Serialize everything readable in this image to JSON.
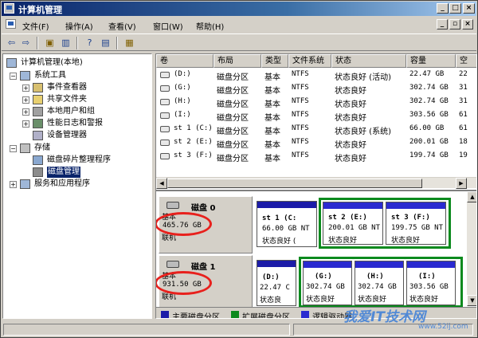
{
  "window": {
    "title": "计算机管理"
  },
  "menu": [
    "文件(F)",
    "操作(A)",
    "查看(V)",
    "窗口(W)",
    "帮助(H)"
  ],
  "tree": {
    "root": "计算机管理(本地)",
    "system_tools": "系统工具",
    "event_viewer": "事件查看器",
    "shared_folders": "共享文件夹",
    "local_users": "本地用户和组",
    "perf_logs": "性能日志和警报",
    "device_manager": "设备管理器",
    "storage": "存储",
    "defrag": "磁盘碎片整理程序",
    "disk_mgmt": "磁盘管理",
    "services_apps": "服务和应用程序"
  },
  "columns": [
    "卷",
    "布局",
    "类型",
    "文件系统",
    "状态",
    "容量",
    "空"
  ],
  "volumes": [
    {
      "name": "(D:)",
      "layout": "磁盘分区",
      "type": "基本",
      "fs": "NTFS",
      "status": "状态良好 (活动)",
      "capacity": "22.47 GB",
      "free": "22"
    },
    {
      "name": "(G:)",
      "layout": "磁盘分区",
      "type": "基本",
      "fs": "NTFS",
      "status": "状态良好",
      "capacity": "302.74 GB",
      "free": "31"
    },
    {
      "name": "(H:)",
      "layout": "磁盘分区",
      "type": "基本",
      "fs": "NTFS",
      "status": "状态良好",
      "capacity": "302.74 GB",
      "free": "31"
    },
    {
      "name": "(I:)",
      "layout": "磁盘分区",
      "type": "基本",
      "fs": "NTFS",
      "status": "状态良好",
      "capacity": "303.56 GB",
      "free": "61"
    },
    {
      "name": "st 1 (C:)",
      "layout": "磁盘分区",
      "type": "基本",
      "fs": "NTFS",
      "status": "状态良好 (系统)",
      "capacity": "66.00 GB",
      "free": "61"
    },
    {
      "name": "st 2 (E:)",
      "layout": "磁盘分区",
      "type": "基本",
      "fs": "NTFS",
      "status": "状态良好",
      "capacity": "200.01 GB",
      "free": "18"
    },
    {
      "name": "st 3 (F:)",
      "layout": "磁盘分区",
      "type": "基本",
      "fs": "NTFS",
      "status": "状态良好",
      "capacity": "199.74 GB",
      "free": "19"
    }
  ],
  "disks": [
    {
      "name": "磁盘 0",
      "type": "基本",
      "size": "465.76 GB",
      "status": "联机",
      "partitions": [
        {
          "name": "st 1 (C:",
          "size": "66.00 GB NT",
          "status": "状态良好 ("
        },
        {
          "name": "st 2 (E:)",
          "size": "200.01 GB NT",
          "status": "状态良好"
        },
        {
          "name": "st 3 (F:)",
          "size": "199.75 GB NT",
          "status": "状态良好"
        }
      ]
    },
    {
      "name": "磁盘 1",
      "type": "基本",
      "size": "931.50 GB",
      "status": "联机",
      "partitions": [
        {
          "name": "(D:)",
          "size": "22.47 C",
          "status": "状态良"
        },
        {
          "name": "(G:)",
          "size": "302.74 GB",
          "status": "状态良好"
        },
        {
          "name": "(H:)",
          "size": "302.74 GB",
          "status": "状态良好"
        },
        {
          "name": "(I:)",
          "size": "303.56 GB",
          "status": "状态良好"
        }
      ]
    }
  ],
  "legend": [
    {
      "label": "主要磁盘分区",
      "color": "#1c1ca8"
    },
    {
      "label": "扩展磁盘分区",
      "color": "#0c8a1e"
    },
    {
      "label": "逻辑驱动器",
      "color": "#2a2ad0"
    }
  ],
  "watermark": {
    "main": "我爱IT技术网",
    "sub": "www.52ij.com"
  },
  "colors": {
    "title_bar": "#0a246a",
    "highlight": "#e8201c",
    "extended": "#0c8a1e",
    "primary": "#1c1ca8"
  }
}
